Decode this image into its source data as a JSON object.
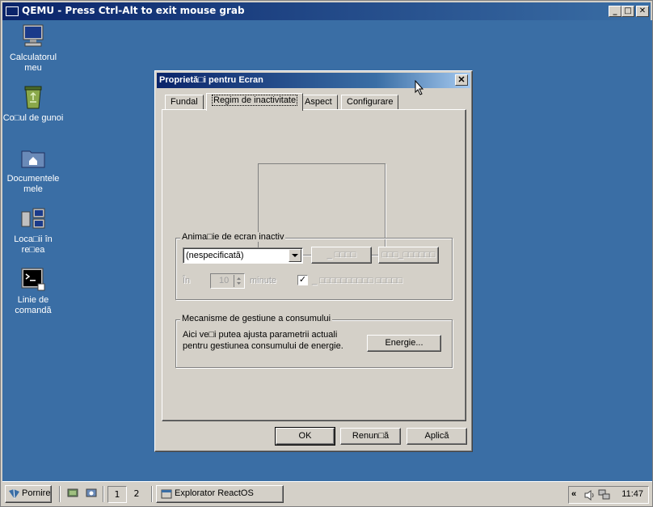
{
  "qemu": {
    "title": "QEMU - Press Ctrl-Alt to exit mouse grab",
    "minimize": "_",
    "maximize": "□",
    "close": "✕"
  },
  "desktop_icons": [
    {
      "label": "Calculatorul meu",
      "icon": "computer-icon"
    },
    {
      "label": "Co□ul de gunoi",
      "icon": "recycle-bin-icon"
    },
    {
      "label": "Documentele mele",
      "icon": "documents-folder-icon"
    },
    {
      "label": "Loca□ii în re□ea",
      "icon": "network-places-icon"
    },
    {
      "label": "Linie de comandă",
      "icon": "command-line-icon"
    }
  ],
  "dialog": {
    "title": "Proprietă□i pentru Ecran",
    "close": "✕",
    "tabs": [
      {
        "label": "Fundal"
      },
      {
        "label": "Regim de inactivitate",
        "active": true
      },
      {
        "label": "Aspect"
      },
      {
        "label": "Configurare"
      }
    ],
    "screensaver_group": {
      "title": "Anima□ie de ecran inactiv",
      "selected": "(nespecificată)",
      "settings_button": "_ □□□□",
      "preview_button": "□□□_□□□□□□",
      "in_label": "În",
      "minutes_value": "10",
      "minutes_label": "minute",
      "password_checked": true,
      "password_label": "_ □□□□□□□□□□ □□□□□"
    },
    "power_group": {
      "title": "Mecanisme de gestiune a consumului",
      "description_line1": "Aici ve□i putea ajusta parametrii actuali",
      "description_line2": "pentru gestiunea consumului de energie.",
      "energy_button": "Energie..."
    },
    "buttons": {
      "ok": "OK",
      "cancel": "Renun□ă",
      "apply": "Aplică"
    }
  },
  "taskbar": {
    "start_label": "Pornire",
    "workspace_1": "1",
    "workspace_2": "2",
    "task_label": "Explorator ReactOS",
    "tray_chevron": "«",
    "clock": "11:47"
  }
}
